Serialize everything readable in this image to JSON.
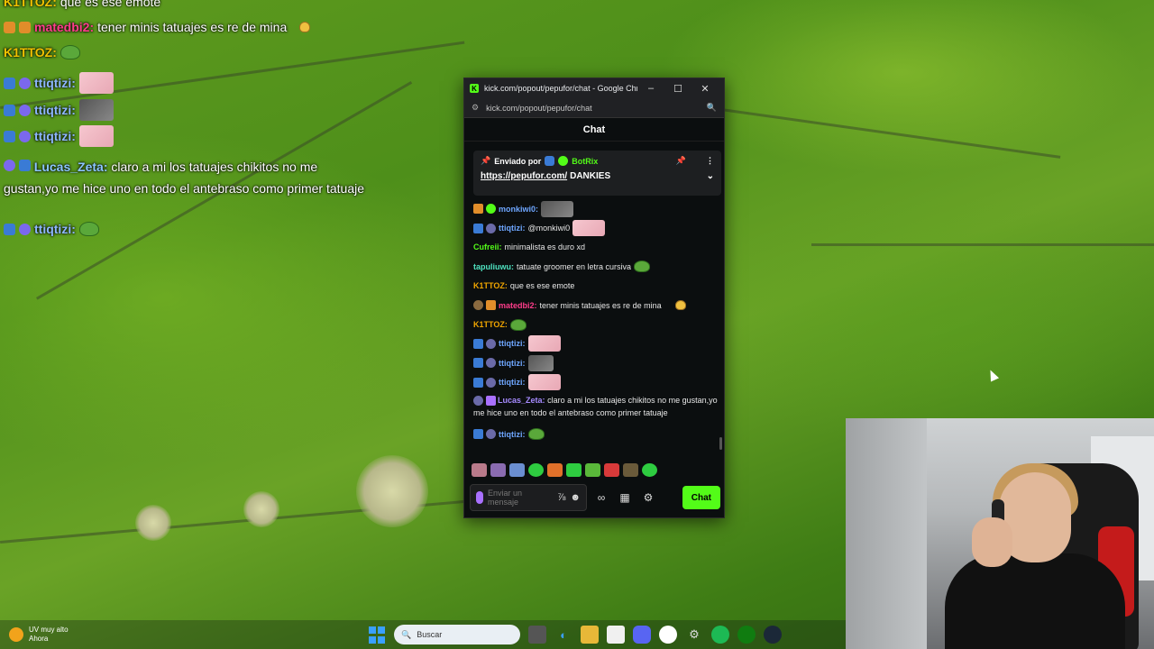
{
  "overlay": {
    "lines": [
      {
        "user": "K1TTOZ:",
        "text": "que es ese emote"
      },
      {
        "user": "matedbi2:",
        "text": "tener minis tatuajes es re de mina"
      },
      {
        "user": "K1TTOZ:",
        "text": ""
      },
      {
        "user": "ttiqtizi:",
        "text": ""
      },
      {
        "user": "ttiqtizi:",
        "text": ""
      },
      {
        "user": "ttiqtizi:",
        "text": ""
      },
      {
        "user": "Lucas_Zeta:",
        "text": "claro a mi los tatuajes chikitos no me gustan,yo me hice uno en todo el antebraso como primer tatuaje"
      },
      {
        "user": "ttiqtizi:",
        "text": ""
      }
    ]
  },
  "window": {
    "title": "kick.com/popout/pepufor/chat - Google Chrome",
    "logo": "K",
    "url": "kick.com/popout/pepufor/chat",
    "minimize": "–",
    "maximize": "☐",
    "close": "✕"
  },
  "chat": {
    "header": "Chat",
    "pinned": {
      "sent_by": "Enviado por",
      "bot": "BotRix",
      "link": "https://pepufor.com/",
      "text": "DANKIES"
    },
    "messages": [
      {
        "user": "monkiwi0:",
        "text": ""
      },
      {
        "user": "ttiqtizi:",
        "text": "@monkiwi0"
      },
      {
        "user": "Cufreii:",
        "text": "minimalista es duro xd"
      },
      {
        "user": "tapuliuwu:",
        "text": "tatuate groomer en letra cursiva"
      },
      {
        "user": "K1TTOZ:",
        "text": "que es ese emote"
      },
      {
        "user": "matedbi2:",
        "text": "tener minis tatuajes es re de mina"
      },
      {
        "user": "K1TTOZ:",
        "text": ""
      },
      {
        "user": "ttiqtizi:",
        "text": ""
      },
      {
        "user": "ttiqtizi:",
        "text": ""
      },
      {
        "user": "ttiqtizi:",
        "text": ""
      },
      {
        "user": "Lucas_Zeta:",
        "text": "claro a mi los tatuajes chikitos no me gustan,yo me hice uno en todo el antebraso como primer tatuaje"
      },
      {
        "user": "ttiqtizi:",
        "text": ""
      }
    ],
    "input_placeholder": "Enviar un mensaje",
    "send_label": "Chat"
  },
  "taskbar": {
    "weather_title": "UV muy alto",
    "weather_sub": "Ahora",
    "search_placeholder": "Buscar"
  },
  "colors": {
    "kick_green": "#53fc18",
    "popup_bg": "#0b0e0f"
  }
}
